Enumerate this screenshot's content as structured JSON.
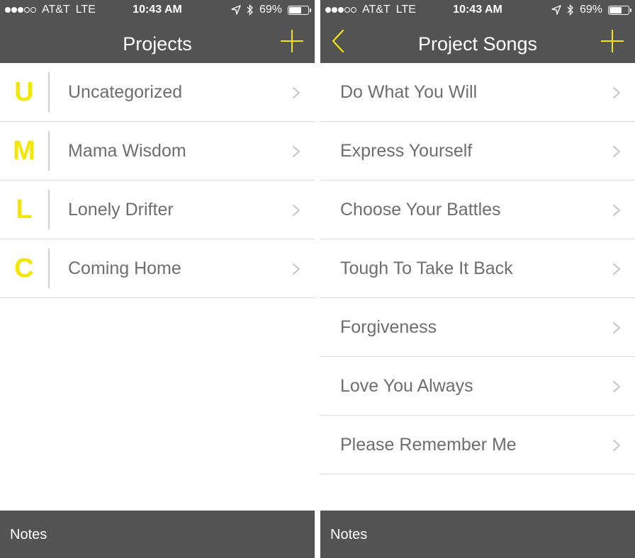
{
  "colors": {
    "bar": "#535353",
    "accent": "#f3e600",
    "text": "#6e6e6e",
    "divider": "#dcdcdc"
  },
  "status": {
    "carrier": "AT&T",
    "network": "LTE",
    "time": "10:43 AM",
    "battery": "69%",
    "battery_level": 0.69,
    "signal_bars": 3,
    "signal_total": 5,
    "icons": [
      "location-icon",
      "bluetooth-icon",
      "battery-icon"
    ]
  },
  "projects_screen": {
    "title": "Projects",
    "add_icon": "plus-icon",
    "items": [
      {
        "letter": "U",
        "label": "Uncategorized"
      },
      {
        "letter": "M",
        "label": "Mama Wisdom"
      },
      {
        "letter": "L",
        "label": "Lonely Drifter"
      },
      {
        "letter": "C",
        "label": "Coming Home"
      }
    ],
    "bottom_label": "Notes"
  },
  "songs_screen": {
    "title": "Project Songs",
    "back_icon": "chevron-left-icon",
    "add_icon": "plus-icon",
    "items": [
      {
        "label": "Do What You Will"
      },
      {
        "label": "Express Yourself"
      },
      {
        "label": "Choose Your Battles"
      },
      {
        "label": "Tough To Take It Back"
      },
      {
        "label": "Forgiveness"
      },
      {
        "label": "Love You Always"
      },
      {
        "label": "Please Remember Me"
      }
    ],
    "bottom_label": "Notes"
  }
}
